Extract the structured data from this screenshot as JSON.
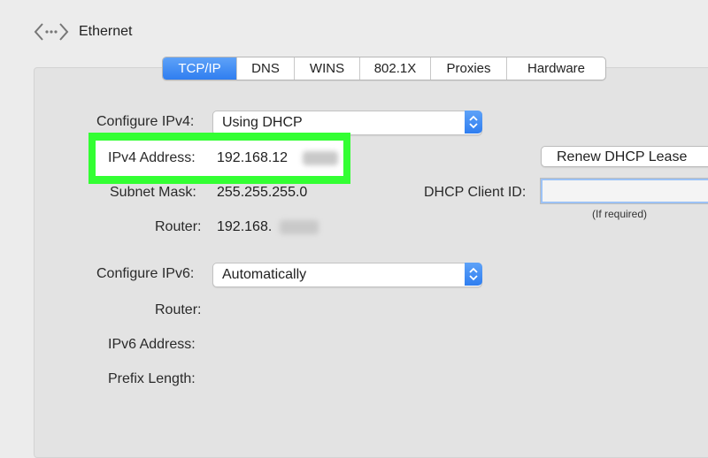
{
  "window": {
    "title": "Ethernet"
  },
  "tabs": [
    "TCP/IP",
    "DNS",
    "WINS",
    "802.1X",
    "Proxies",
    "Hardware"
  ],
  "ipv4": {
    "configure_label": "Configure IPv4:",
    "configure_value": "Using DHCP",
    "address_label": "IPv4 Address:",
    "address_value": "192.168.12",
    "subnet_label": "Subnet Mask:",
    "subnet_value": "255.255.255.0",
    "router_label": "Router:",
    "router_value": "192.168."
  },
  "dhcp": {
    "renew_button": "Renew DHCP Lease",
    "client_id_label": "DHCP Client ID:",
    "client_id_value": "",
    "client_id_note": "(If required)"
  },
  "ipv6": {
    "configure_label": "Configure IPv6:",
    "configure_value": "Automatically",
    "router_label": "Router:",
    "address_label": "IPv6 Address:",
    "prefix_label": "Prefix Length:"
  },
  "colors": {
    "accent": "#2f7ef0",
    "highlight": "#33ff33",
    "background": "#ececec"
  },
  "icons": [
    "network-arrows-icon",
    "chevron-up-down-icon"
  ]
}
